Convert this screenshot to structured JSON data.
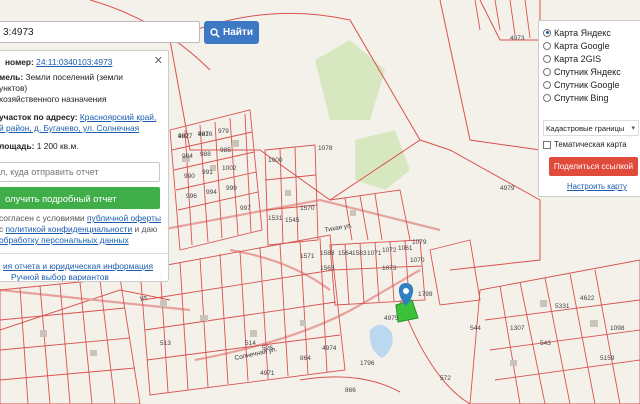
{
  "search": {
    "value": "3:4973",
    "button_label": "Найти"
  },
  "map": {
    "parcel_labels": [
      "982",
      "981",
      "979",
      "984",
      "988",
      "985",
      "990",
      "991",
      "1002",
      "996",
      "994",
      "999",
      "997",
      "1000",
      "1531",
      "1545",
      "1570",
      "1571",
      "1588",
      "1563",
      "1564",
      "1583",
      "1071",
      "1072",
      "1073",
      "1061",
      "1078",
      "1079",
      "1070",
      "1799",
      "1796",
      "4974",
      "4975",
      "4979",
      "4973",
      "5331",
      "1307",
      "543",
      "514",
      "526",
      "513",
      "4622",
      "1098",
      "5159",
      "544",
      "572",
      "866",
      "864",
      "4971",
      "4977",
      "4976"
    ],
    "street_labels": [
      "Тихая ул.",
      "Солнечная ул.",
      "ул."
    ]
  },
  "info": {
    "cadastral_label": "номер:",
    "cadastral_value": "24:11:0340103:4973",
    "category_label": "мель:",
    "category_value_1": "Земли поселений (земли",
    "category_value_2": "унктов)",
    "usage": "хозяйственного назначения",
    "address_label": "участок по адресу:",
    "address_value_1": "Красноярский край,",
    "address_value_2": "й район, д. Бугачево, ул. Солнечная",
    "area_label": "лощадь:",
    "area_value": "1 200 кв.м.",
    "email_placeholder": "л, куда отправить отчет",
    "report_button": "олучить подробный отчет",
    "terms_1": "согласен с условиями",
    "terms_link_1": "публичной оферты",
    "terms_2": "с",
    "terms_link_2": "политикой конфиденциальности",
    "terms_3": "и даю",
    "terms_link_3": "обработку персональных данных",
    "example_link": "ия отчета и юридическая информация",
    "manual_link": "Ручной выбор вариантов"
  },
  "layers": {
    "options": [
      "Карта Яндекс",
      "Карта Google",
      "Карта 2GIS",
      "Спутник Яндекс",
      "Спутник Google",
      "Спутник Bing"
    ],
    "selected_index": 0,
    "overlay_select": "Кадастровые границы",
    "thematic_label": "Тематическая карта",
    "share_button": "Поделиться ссылкой",
    "settings_link": "Настроить карту"
  },
  "colors": {
    "accent_blue": "#3c78c3",
    "report_green": "#3fae49",
    "share_red": "#e14b3c",
    "parcel_line": "#d9534f",
    "pin_blue": "#2f7fc1",
    "parcel_green": "#39c23a"
  }
}
